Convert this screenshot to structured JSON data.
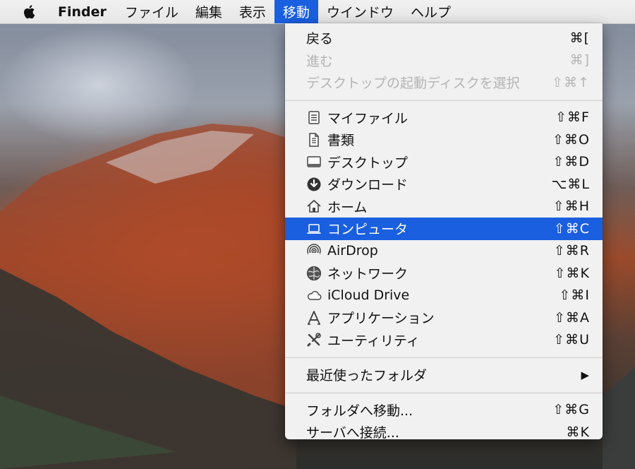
{
  "menubar": {
    "apple_icon": "apple-logo-icon",
    "app_name": "Finder",
    "items": [
      "ファイル",
      "編集",
      "表示",
      "移動",
      "ウインドウ",
      "ヘルプ"
    ],
    "active": "移動"
  },
  "menu": {
    "section1": [
      {
        "label": "戻る",
        "shortcut": "⌘[",
        "enabled": true
      },
      {
        "label": "進む",
        "shortcut": "⌘]",
        "enabled": false
      },
      {
        "label": "デスクトップの起動ディスクを選択",
        "shortcut": "⇧⌘↑",
        "enabled": false
      }
    ],
    "section2": [
      {
        "label": "マイファイル",
        "shortcut": "⇧⌘F",
        "icon": "all-my-files-icon"
      },
      {
        "label": "書類",
        "shortcut": "⇧⌘O",
        "icon": "documents-icon"
      },
      {
        "label": "デスクトップ",
        "shortcut": "⇧⌘D",
        "icon": "desktop-icon"
      },
      {
        "label": "ダウンロード",
        "shortcut": "⌥⌘L",
        "icon": "downloads-icon"
      },
      {
        "label": "ホーム",
        "shortcut": "⇧⌘H",
        "icon": "home-icon"
      },
      {
        "label": "コンピュータ",
        "shortcut": "⇧⌘C",
        "icon": "computer-icon",
        "selected": true
      },
      {
        "label": "AirDrop",
        "shortcut": "⇧⌘R",
        "icon": "airdrop-icon"
      },
      {
        "label": "ネットワーク",
        "shortcut": "⇧⌘K",
        "icon": "network-icon"
      },
      {
        "label": "iCloud Drive",
        "shortcut": "⇧⌘I",
        "icon": "icloud-icon"
      },
      {
        "label": "アプリケーション",
        "shortcut": "⇧⌘A",
        "icon": "applications-icon"
      },
      {
        "label": "ユーティリティ",
        "shortcut": "⇧⌘U",
        "icon": "utilities-icon"
      }
    ],
    "section3": [
      {
        "label": "最近使ったフォルダ",
        "shortcut": "▶"
      }
    ],
    "section4": [
      {
        "label": "フォルダへ移動...",
        "shortcut": "⇧⌘G"
      },
      {
        "label": "サーバへ接続...",
        "shortcut": "⌘K"
      }
    ]
  },
  "colors": {
    "highlight": "#1a5fe0",
    "menu_bg": "#f1f1f1",
    "disabled": "#b4b4b4"
  }
}
